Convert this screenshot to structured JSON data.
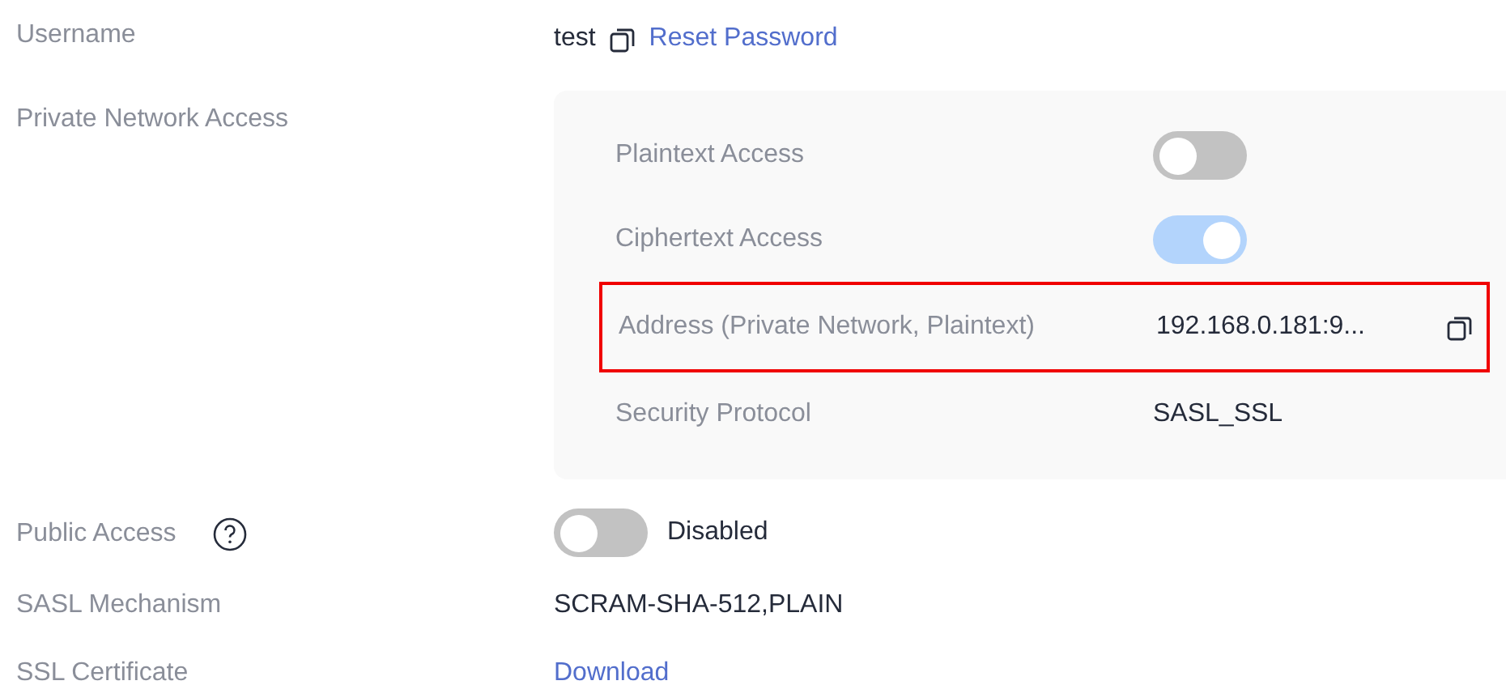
{
  "username": {
    "label": "Username",
    "value": "test",
    "link": "Reset Password"
  },
  "private_network_access": {
    "label": "Private Network Access",
    "rows": [
      {
        "kind": "toggle",
        "label": "Plaintext Access",
        "on": false,
        "highlighted": false
      },
      {
        "kind": "toggle",
        "label": "Ciphertext Access",
        "on": true,
        "highlighted": false
      },
      {
        "kind": "copy-text",
        "label": "Address (Private Network, Plaintext)",
        "value": "192.168.0.181:9...",
        "highlighted": true
      },
      {
        "kind": "text",
        "label": "Security Protocol",
        "value": "SASL_SSL",
        "highlighted": false
      }
    ]
  },
  "public_access": {
    "label": "Public Access",
    "on": false,
    "status": "Disabled"
  },
  "sasl_mechanism": {
    "label": "SASL Mechanism",
    "value": "SCRAM-SHA-512,PLAIN"
  },
  "ssl_certificate": {
    "label": "SSL Certificate",
    "link": "Download"
  }
}
